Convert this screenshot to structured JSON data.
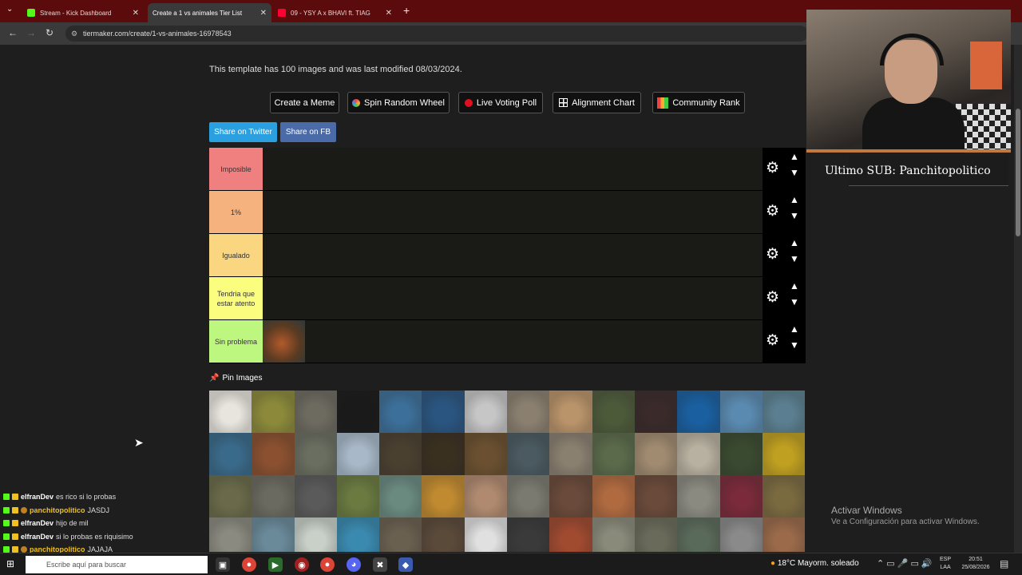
{
  "browser": {
    "tabs": [
      {
        "label": "Stream - Kick Dashboard",
        "favicon_color": "#53fc18"
      },
      {
        "label": "Create a 1 vs animales Tier List",
        "favicon_color": "#ffffff"
      },
      {
        "label": "09 - YSY A x BHAVI ft. TIAG",
        "favicon_color": "#ff0033"
      }
    ],
    "url": "tiermaker.com/create/1-vs-animales-16978543"
  },
  "page": {
    "description": "This template has 100 images and was last modified 08/03/2024.",
    "buttons": {
      "meme": "Create a Meme",
      "wheel": "Spin Random Wheel",
      "poll": "Live Voting Poll",
      "align": "Alignment Chart",
      "rank": "Community Rank"
    },
    "share": {
      "twitter": "Share on Twitter",
      "fb": "Share on FB"
    },
    "tiers": [
      {
        "label": "Imposible",
        "color": "#f07f7f"
      },
      {
        "label": "1%",
        "color": "#f5b27f"
      },
      {
        "label": "Igualado",
        "color": "#f9d67f"
      },
      {
        "label": "Tendria que estar atento",
        "color": "#fbfd7f"
      },
      {
        "label": "Sin problema",
        "color": "#bdf77f"
      }
    ],
    "pin_label": "Pin Images"
  },
  "overlay": {
    "last_sub": "Ultimo SUB: Panchitopolitico",
    "activate_title": "Activar Windows",
    "activate_sub": "Ve a Configuración para activar Windows."
  },
  "chat": [
    {
      "user": "elfranDev",
      "text": "es rico si lo probas",
      "gold": false
    },
    {
      "user": "panchitopolitico",
      "text": "JASDJ",
      "gold": true
    },
    {
      "user": "elfranDev",
      "text": "hijo de mil",
      "gold": false
    },
    {
      "user": "elfranDev",
      "text": "si lo probas es riquisimo",
      "gold": false
    },
    {
      "user": "panchitopolitico",
      "text": "JAJAJA",
      "gold": true
    }
  ],
  "taskbar": {
    "search_placeholder": "Escribe aquí para buscar",
    "weather": "18°C  Mayorm. soleado",
    "lang": "ESP",
    "lang2": "LAA",
    "time": "20:51",
    "date": "25/08/2026"
  },
  "grid_colors": [
    "#e8e4de",
    "#8c8a3a",
    "#6d6a60",
    "#1a1a1a",
    "#3c6f99",
    "#2a5580",
    "#c6c6c6",
    "#8b8070",
    "#b9936a",
    "#4d5a3a",
    "#3a2a2a",
    "#1a5fa0",
    "#5a8ab0",
    "#5b7f90",
    "#3a6a8a",
    "#8a5030",
    "#6a6e60",
    "#a8b8c8",
    "#4a4030",
    "#3a3020",
    "#6a5030",
    "#4a5a60",
    "#8a8070",
    "#5a6a4a",
    "#a08a70",
    "#b8b0a0",
    "#3a4a30",
    "#c0a020",
    "#6a6a4a",
    "#6a6a60",
    "#5a5a5a",
    "#6a7a40",
    "#6a8a80",
    "#c08a30",
    "#b08a70",
    "#7a7a70",
    "#6a4a3a",
    "#b06a40",
    "#6a4a3a",
    "#8a8a80",
    "#7a2a3a",
    "#7a6a40",
    "#8a8a80",
    "#6a8a9a",
    "#c8d0c8",
    "#3a8ab0",
    "#6a6050",
    "#5a4a3a",
    "#e0e0e0",
    "#3a3a3a",
    "#a04a30",
    "#8a8a7a",
    "#6a6a5a",
    "#5a6a5a",
    "#8a8a8a",
    "#9a6a4a"
  ]
}
